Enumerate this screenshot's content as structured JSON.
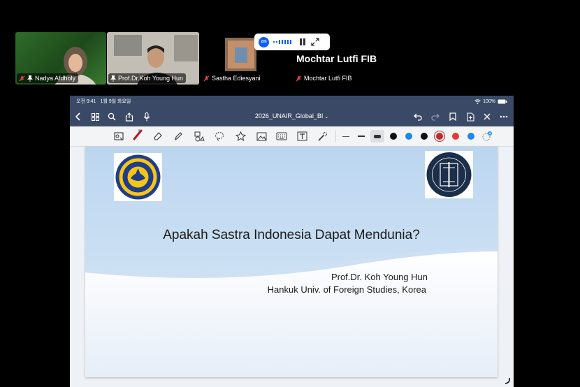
{
  "participants": [
    {
      "name": "Nadya Afdholy"
    },
    {
      "name": "Prof.Dr.Koh Young Hun"
    },
    {
      "name": "Sastha Ediesyani"
    },
    {
      "name": "Mochtar Lutfi FIB"
    }
  ],
  "zoom_bar": {
    "logo": "zm"
  },
  "featured_name": "Mochtar Lutfi FIB",
  "ipad": {
    "status": {
      "time": "오전 9:41",
      "date": "1월 9일 화요일",
      "battery": "100%"
    },
    "document_title": "2026_UNAIR_Global_BI",
    "toolbar_icons": [
      "image-lasso-icon",
      "pen-icon",
      "eraser-icon",
      "highlighter-icon",
      "shapes-icon",
      "lasso-icon",
      "sticker-icon",
      "image-icon",
      "keyboard-icon",
      "text-box-icon",
      "laser-pointer-icon"
    ],
    "pen_colors": [
      "#111111",
      "#1e88e5",
      "#111111",
      "#c62828",
      "#e53935",
      "#1e88e5"
    ]
  },
  "slide": {
    "title": "Apakah Sastra Indonesia Dapat Mendunia?",
    "author": "Prof.Dr. Koh Young Hun",
    "affiliation": "Hankuk Univ. of Foreign Studies, Korea",
    "logo_left_text": "UNIVERSITAS AIRLANGGA",
    "logo_left_sub": "UNAIR",
    "logo_right_text": "HANKUK UNIVERSITY OF FOREIGN STUDIES"
  },
  "colors": {
    "active_speaker": "#2ecc40",
    "ipad_bar": "#3a4a66",
    "zoom_blue": "#0b5cff",
    "mic_off_red": "#e5484d"
  }
}
